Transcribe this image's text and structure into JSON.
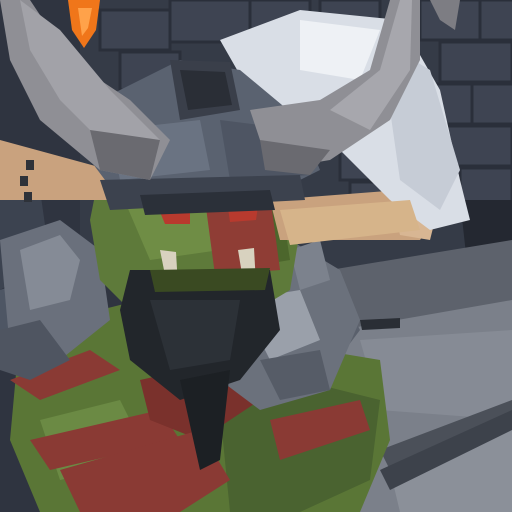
{
  "scene": {
    "title": "",
    "subject": "orc-warrior",
    "environment": "stone-dungeon",
    "hud_visible": false
  },
  "palette": {
    "stone_dark": "#2f3440",
    "stone_mid": "#3d4350",
    "stone_light": "#4a505e",
    "floor": "#7a7f89",
    "horn_light": "#8f8f95",
    "horn_dark": "#5c5c62",
    "helmet_steel": "#5a6270",
    "helmet_dark": "#3a3f4a",
    "cloth_white": "#d9dee6",
    "skin_green": "#5e7a3a",
    "skin_dark": "#3f5326",
    "skin_light": "#7e9a52",
    "beard_dark": "#22262b",
    "armor_red": "#8a3a34",
    "tusk": "#d8d2bf",
    "eye_red": "#b83a2e",
    "torch_orange": "#f0761a",
    "axe_handle": "#d6b48a",
    "ear_tan": "#c9a27e"
  }
}
